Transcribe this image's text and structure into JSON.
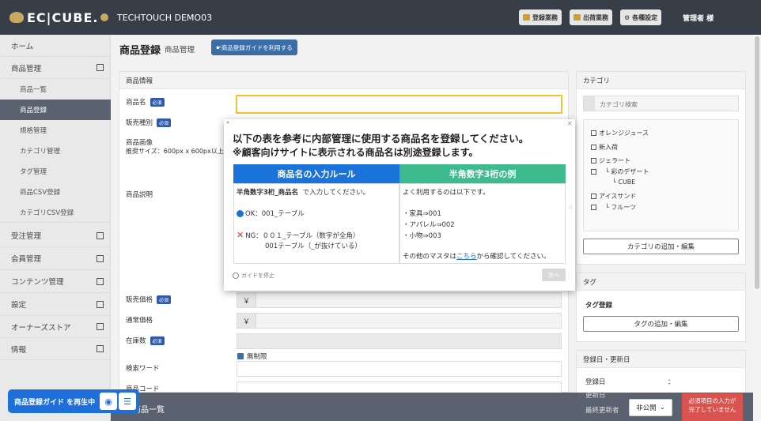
{
  "header": {
    "logo_text": "EC|CUBE.",
    "shop_name": "TECHTOUCH DEMO03",
    "btn_register": "登録業務",
    "btn_shipping": "出荷業務",
    "btn_settings": "各種設定",
    "user": "管理者 様"
  },
  "sidebar": {
    "items": [
      {
        "label": "ホーム"
      },
      {
        "label": "商品管理"
      },
      {
        "label": "受注管理"
      },
      {
        "label": "会員管理"
      },
      {
        "label": "コンテンツ管理"
      },
      {
        "label": "設定"
      },
      {
        "label": "オーナーズストア"
      },
      {
        "label": "情報"
      }
    ],
    "sub_items": [
      {
        "label": "商品一覧"
      },
      {
        "label": "商品登録"
      },
      {
        "label": "規格管理"
      },
      {
        "label": "カテゴリ管理"
      },
      {
        "label": "タグ管理"
      },
      {
        "label": "商品CSV登録"
      },
      {
        "label": "カテゴリCSV登録"
      }
    ]
  },
  "page": {
    "title": "商品登録",
    "subtitle": "商品管理",
    "guide_button": "☛商品登録ガイドを利用する"
  },
  "product_info": {
    "heading": "商品情報",
    "name_label": "商品名",
    "required": "必須",
    "type_label": "販売種別",
    "image_label": "商品画像",
    "image_note": "推奨サイズ：600px x 600px以上",
    "desc_label": "商品説明",
    "price_label": "販売価格",
    "normal_price_label": "通常価格",
    "currency": "￥",
    "stock_label": "在庫数",
    "unlimited_label": "無制限",
    "search_word_label": "検索ワード",
    "code_label": "商品コード"
  },
  "category": {
    "heading": "カテゴリ",
    "search_placeholder": "カテゴリ検索",
    "items": [
      "オレンジジュース",
      "新入荷",
      "ジェラート",
      "└ 彩のデザート",
      "└ CUBE",
      "アイスサンド",
      "└ フルーツ"
    ],
    "edit_button": "カテゴリの追加・編集"
  },
  "tag": {
    "heading": "タグ",
    "reg_label": "タグ登録",
    "edit_button": "タグの追加・編集"
  },
  "dates": {
    "heading": "登録日・更新日",
    "reg_label": "登録日",
    "sep": "：",
    "upd_label": "更新日",
    "last_upd_label": "最終更新者"
  },
  "guide": {
    "line1": "以下の表を参考に内部管理に使用する商品名を登録してください。",
    "line2": "※顧客向けサイトに表示される商品名は別途登録します。",
    "col1_title": "商品名の入力ルール",
    "col2_title": "半角数字3桁の例",
    "col1_rule_bold": "半角数字3桁_商品名",
    "col1_rule_rest": "で入力してください。",
    "ok_text": "OK：001_テーブル",
    "ng_text": "NG：００１_テーブル（数字が全角）",
    "ng_text2": "001テーブル（_が抜けている）",
    "col2_intro": "よく利用するのは以下です。",
    "ex1": "・家具⇒001",
    "ex2": "・アパレル⇒002",
    "ex3": "・小物⇒003",
    "other_prefix": "その他のマスタは",
    "other_link": "こちら",
    "other_suffix": "から確認してください。",
    "stop_label": "ガイドを停止",
    "next_label": "次へ",
    "colors": {
      "blue": "#1a73d9",
      "green": "#3dbb8f"
    }
  },
  "footer": {
    "list_label": "商品一覧",
    "status_select": "非公開",
    "alert": "必須項目の入力が完了していません",
    "playing_pill": "商品登録ガイド を再生中"
  }
}
